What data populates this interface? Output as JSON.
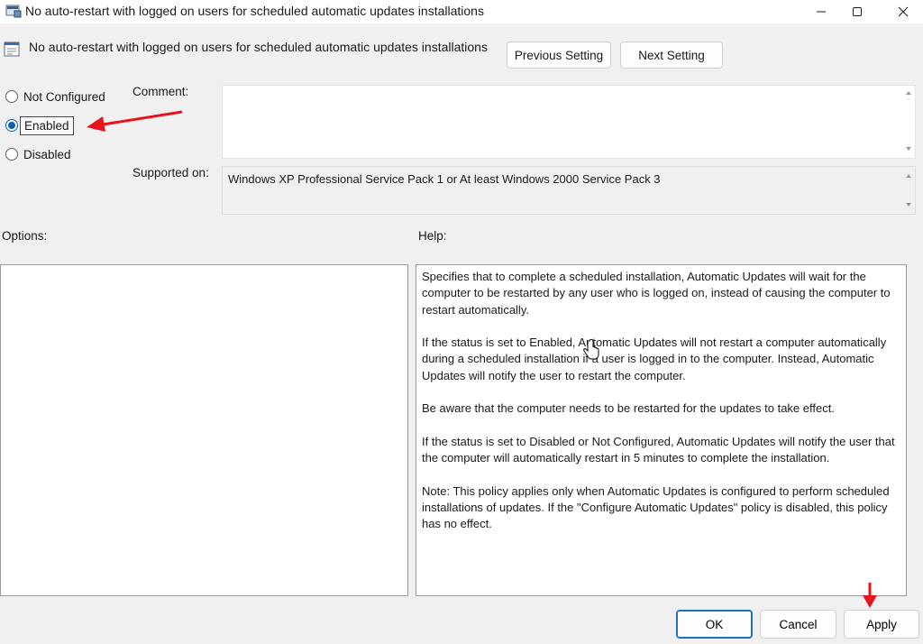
{
  "window": {
    "title": "No auto-restart with logged on users for scheduled automatic updates installations"
  },
  "header": {
    "policy_title": "No auto-restart with logged on users for scheduled automatic updates installations",
    "prev_label": "Previous Setting",
    "next_label": "Next Setting"
  },
  "state": {
    "options": [
      {
        "label": "Not Configured",
        "checked": false
      },
      {
        "label": "Enabled",
        "checked": true
      },
      {
        "label": "Disabled",
        "checked": false
      }
    ]
  },
  "comment": {
    "label": "Comment:",
    "value": ""
  },
  "supported": {
    "label": "Supported on:",
    "value": "Windows XP Professional Service Pack 1 or At least Windows 2000 Service Pack 3"
  },
  "options_pane": {
    "label": "Options:"
  },
  "help_pane": {
    "label": "Help:",
    "paragraphs": [
      "Specifies that to complete a scheduled installation, Automatic Updates will wait for the computer to be restarted by any user who is logged on, instead of causing the computer to restart automatically.",
      "If the status is set to Enabled, Automatic Updates will not restart a computer automatically during a scheduled installation if a user is logged in to the computer. Instead, Automatic Updates will notify the user to restart the computer.",
      "Be aware that the computer needs to be restarted for the updates to take effect.",
      "If the status is set to Disabled or Not Configured, Automatic Updates will notify the user that the computer will automatically restart in 5 minutes to complete the installation.",
      "Note: This policy applies only when Automatic Updates is configured to perform scheduled installations of updates. If the \"Configure Automatic Updates\" policy is disabled, this policy has no effect."
    ]
  },
  "footer": {
    "ok_label": "OK",
    "cancel_label": "Cancel",
    "apply_label": "Apply"
  },
  "colors": {
    "annotation_arrow": "#e8141c",
    "radio_selected": "#0a5fb4"
  }
}
